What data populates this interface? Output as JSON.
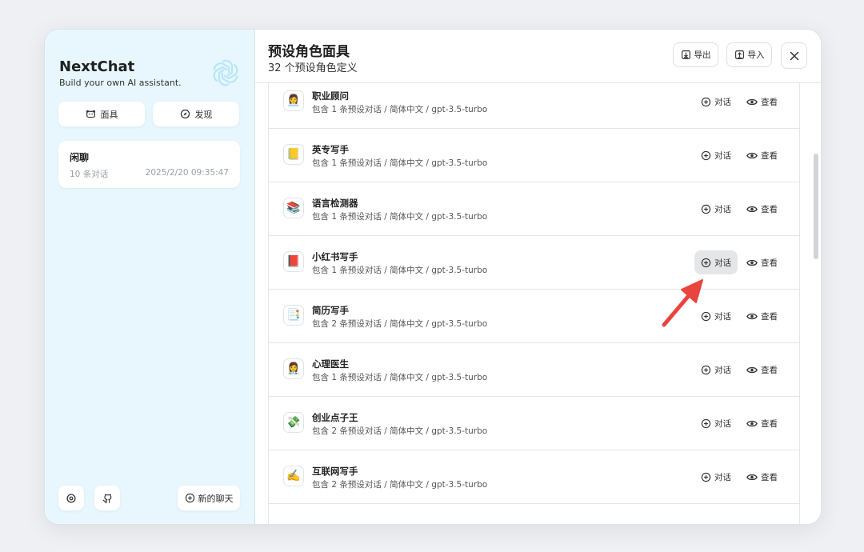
{
  "sidebar": {
    "title": "NextChat",
    "subtitle": "Build your own AI assistant.",
    "logo_icon": "openai-logo-icon",
    "masks_label": "面具",
    "discover_label": "发现",
    "chat": {
      "title": "闲聊",
      "count": "10 条对话",
      "date": "2025/2/20 09:35:47"
    },
    "new_chat_label": "新的聊天"
  },
  "header": {
    "title": "预设角色面具",
    "subtitle": "32 个预设角色定义",
    "export_label": "导出",
    "import_label": "导入"
  },
  "masks": [
    {
      "name": "职业顾问",
      "info": "包含 1 条预设对话 / 简体中文 / gpt-3.5-turbo",
      "emoji": "👩‍💼",
      "chat_label": "对话",
      "view_label": "查看"
    },
    {
      "name": "英专写手",
      "info": "包含 1 条预设对话 / 简体中文 / gpt-3.5-turbo",
      "emoji": "📒",
      "chat_label": "对话",
      "view_label": "查看"
    },
    {
      "name": "语言检测器",
      "info": "包含 1 条预设对话 / 简体中文 / gpt-3.5-turbo",
      "emoji": "📚",
      "chat_label": "对话",
      "view_label": "查看"
    },
    {
      "name": "小红书写手",
      "info": "包含 1 条预设对话 / 简体中文 / gpt-3.5-turbo",
      "emoji": "📕",
      "chat_label": "对话",
      "view_label": "查看"
    },
    {
      "name": "简历写手",
      "info": "包含 2 条预设对话 / 简体中文 / gpt-3.5-turbo",
      "emoji": "📑",
      "chat_label": "对话",
      "view_label": "查看"
    },
    {
      "name": "心理医生",
      "info": "包含 1 条预设对话 / 简体中文 / gpt-3.5-turbo",
      "emoji": "👩‍⚕️",
      "chat_label": "对话",
      "view_label": "查看"
    },
    {
      "name": "创业点子王",
      "info": "包含 2 条预设对话 / 简体中文 / gpt-3.5-turbo",
      "emoji": "💸",
      "chat_label": "对话",
      "view_label": "查看"
    },
    {
      "name": "互联网写手",
      "info": "包含 2 条预设对话 / 简体中文 / gpt-3.5-turbo",
      "emoji": "✍️",
      "chat_label": "对话",
      "view_label": "查看"
    }
  ],
  "colors": {
    "sidebar_bg": "#e7f7fd",
    "hover_bg": "#e5e6e8",
    "arrow": "#e9443d"
  }
}
